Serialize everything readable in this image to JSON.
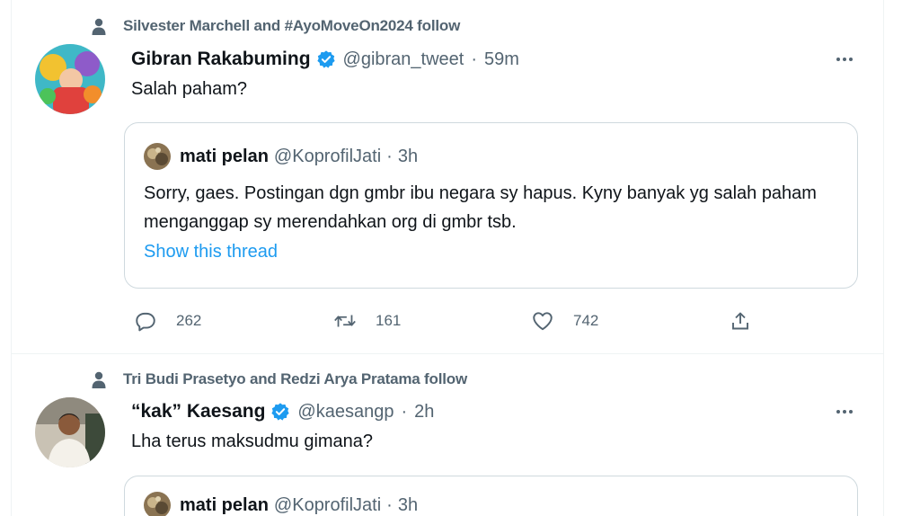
{
  "tweets": [
    {
      "social_context": "Silvester Marchell and #AyoMoveOn2024 follow",
      "name": "Gibran Rakabuming",
      "handle": "@gibran_tweet",
      "separator": "·",
      "time": "59m",
      "text": "Salah paham?",
      "quote": {
        "name": "mati pelan",
        "handle": "@KoprofilJati",
        "separator": "·",
        "time": "3h",
        "text": "Sorry, gaes. Postingan dgn gmbr ibu negara sy hapus. Kyny banyak yg salah paham menganggap sy merendahkan org di gmbr tsb.",
        "link": "Show this thread"
      },
      "replies": "262",
      "retweets": "161",
      "likes": "742"
    },
    {
      "social_context": "Tri Budi Prasetyo and Redzi Arya Pratama follow",
      "name": "“kak” Kaesang",
      "handle": "@kaesangp",
      "separator": "·",
      "time": "2h",
      "text": "Lha terus maksudmu gimana?",
      "quote": {
        "name": "mati pelan",
        "handle": "@KoprofilJati",
        "separator": "·",
        "time": "3h"
      }
    }
  ],
  "colors": {
    "primary_text": "#0f1419",
    "secondary_text": "#536471",
    "link": "#1d9bf0",
    "verified": "#1d9bf0",
    "border": "#cfd9de"
  },
  "icons": [
    "person-icon",
    "verified-badge-icon",
    "more-icon",
    "reply-icon",
    "retweet-icon",
    "like-icon",
    "share-icon"
  ]
}
